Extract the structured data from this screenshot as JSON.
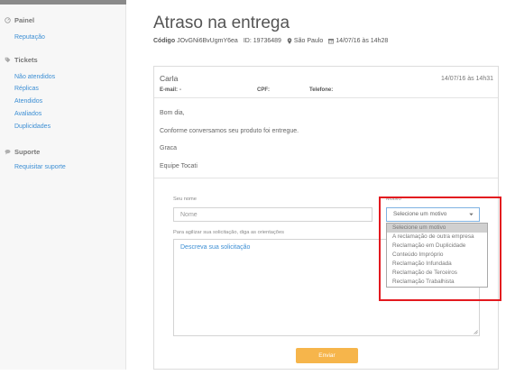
{
  "sidebar": {
    "sections": [
      {
        "title": "Painel",
        "icon": "dashboard-icon",
        "items": [
          {
            "label": "Reputação"
          }
        ]
      },
      {
        "title": "Tickets",
        "icon": "tag-icon",
        "items": [
          {
            "label": "Não atendidos"
          },
          {
            "label": "Réplicas"
          },
          {
            "label": "Atendidos"
          },
          {
            "label": "Avaliados"
          },
          {
            "label": "Duplicidades"
          }
        ]
      },
      {
        "title": "Suporte",
        "icon": "chat-icon",
        "items": [
          {
            "label": "Requisitar suporte"
          }
        ]
      }
    ]
  },
  "ticket": {
    "title": "Atraso na entrega",
    "code_label": "Código",
    "code": "JOvGNi6BvUgmY6ea",
    "id_label": "ID:",
    "id": "19736489",
    "location_icon": "map-pin-icon",
    "location": "São Paulo",
    "date_icon": "calendar-icon",
    "created_at": "14/07/16 às 14h28"
  },
  "message": {
    "author": "Carla",
    "date": "14/07/16 às 14h31",
    "email_label": "E-mail:",
    "email_value": "-",
    "cpf_label": "CPF:",
    "phone_label": "Telefone:",
    "lines": [
      "Bom dia,",
      "Conforme conversamos seu produto foi entregue.",
      "Graca",
      "Equipe Tocati"
    ]
  },
  "form": {
    "name_label": "Seu nome",
    "name_placeholder": "Nome",
    "reason_label": "Motivo",
    "reason_selected": "Selecione um motivo",
    "reason_options": [
      {
        "label": "Selecione um motivo",
        "highlighted": true
      },
      {
        "label": "A reclamação de outra empresa"
      },
      {
        "label": "Reclamação em Duplicidade"
      },
      {
        "label": "Conteúdo Impróprio"
      },
      {
        "label": "Reclamação Infundada"
      },
      {
        "label": "Reclamação de Terceiros"
      },
      {
        "label": "Reclamação Trabalhista"
      }
    ],
    "request_label": "Para agilizar sua solicitação, diga as orientações",
    "request_placeholder": "Descreva sua solicitação",
    "submit_label": "Enviar"
  },
  "colors": {
    "link": "#3d8fd4",
    "submit_button": "#f6b54b",
    "annotation_border": "#e3191f",
    "option_highlight": "#d0d0d0",
    "sidebar_background": "#f7f7f7"
  }
}
